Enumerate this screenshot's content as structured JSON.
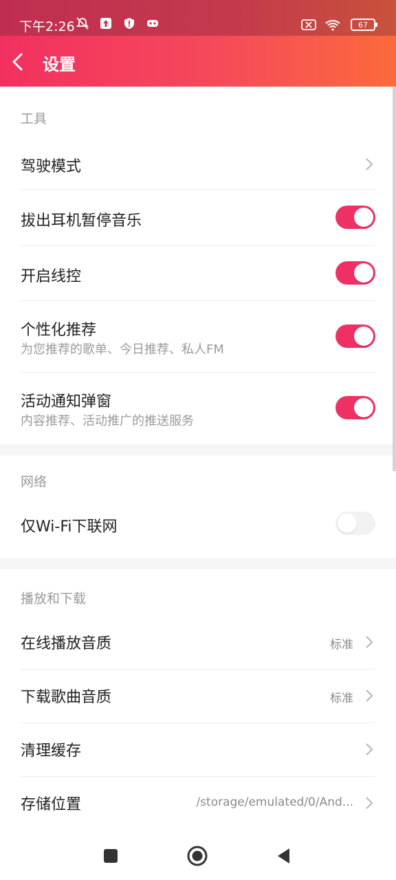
{
  "status": {
    "time": "下午2:26",
    "battery": "67",
    "icons_left": [
      "mute-icon",
      "upload-icon",
      "shield-icon",
      "game-icon"
    ],
    "icons_right": [
      "sim-off-icon",
      "wifi-icon",
      "battery-icon"
    ]
  },
  "header": {
    "title": "设置",
    "gradient": [
      "#f2305f",
      "#fb6a3c"
    ]
  },
  "accent": "#ee3064",
  "sections": {
    "tools": {
      "title": "工具",
      "driving_mode": "驾驶模式",
      "unplug_pause": {
        "label": "拔出耳机暂停音乐",
        "on": true
      },
      "line_control": {
        "label": "开启线控",
        "on": true
      },
      "personalized": {
        "label": "个性化推荐",
        "sub": "为您推荐的歌单、今日推荐、私人FM",
        "on": true
      },
      "activity_popup": {
        "label": "活动通知弹窗",
        "sub": "内容推荐、活动推广的推送服务",
        "on": true
      }
    },
    "network": {
      "title": "网络",
      "wifi_only": {
        "label": "仅Wi-Fi下联网",
        "on": false
      }
    },
    "playback": {
      "title": "播放和下载",
      "online_quality": {
        "label": "在线播放音质",
        "value": "标准"
      },
      "download_quality": {
        "label": "下载歌曲音质",
        "value": "标准"
      },
      "clear_cache": {
        "label": "清理缓存"
      },
      "storage": {
        "label": "存储位置",
        "value": "/storage/emulated/0/And..."
      }
    }
  },
  "navbar": [
    "recent-apps-button",
    "home-button",
    "back-nav-button"
  ]
}
